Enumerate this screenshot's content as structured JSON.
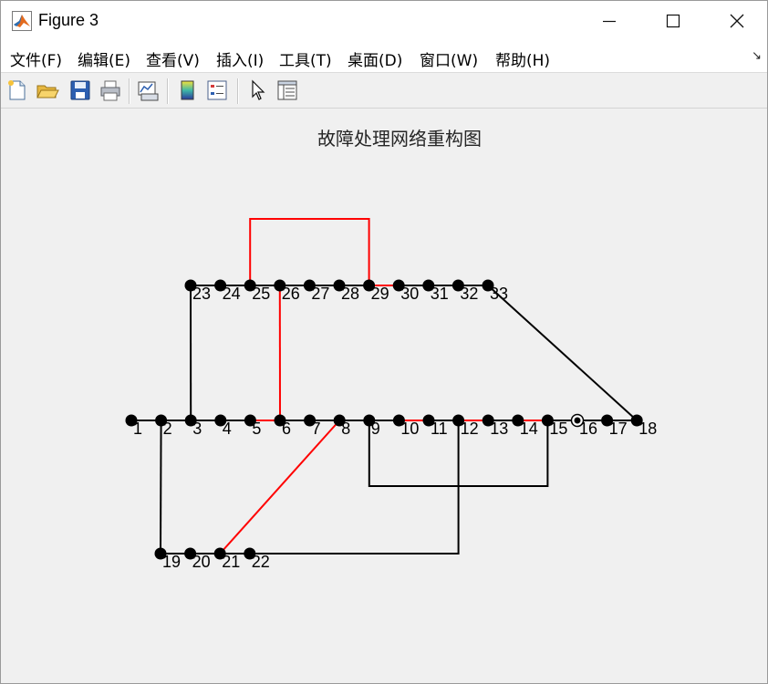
{
  "window": {
    "title": "Figure 3"
  },
  "menu": [
    {
      "label": "文件(F)"
    },
    {
      "label": "编辑(E)"
    },
    {
      "label": "查看(V)"
    },
    {
      "label": "插入(I)"
    },
    {
      "label": "工具(T)"
    },
    {
      "label": "桌面(D)"
    },
    {
      "label": "窗口(W)"
    },
    {
      "label": "帮助(H)"
    }
  ],
  "toolbar": [
    {
      "icon": "new-figure-icon"
    },
    {
      "icon": "open-file-icon"
    },
    {
      "icon": "save-icon"
    },
    {
      "icon": "print-icon"
    },
    {
      "icon": "link-plot-icon"
    },
    {
      "icon": "colorbar-icon"
    },
    {
      "icon": "legend-icon"
    },
    {
      "icon": "pointer-icon"
    },
    {
      "icon": "property-inspector-icon"
    }
  ],
  "figure": {
    "title": "故障处理网络重构图",
    "colors": {
      "black": "#000000",
      "red": "#ff0000"
    },
    "nodes": [
      {
        "id": "1"
      },
      {
        "id": "2"
      },
      {
        "id": "3"
      },
      {
        "id": "4"
      },
      {
        "id": "5"
      },
      {
        "id": "6"
      },
      {
        "id": "7"
      },
      {
        "id": "8"
      },
      {
        "id": "9"
      },
      {
        "id": "10"
      },
      {
        "id": "11"
      },
      {
        "id": "12"
      },
      {
        "id": "13"
      },
      {
        "id": "14"
      },
      {
        "id": "15"
      },
      {
        "id": "16",
        "style": "ring"
      },
      {
        "id": "17"
      },
      {
        "id": "18"
      },
      {
        "id": "19"
      },
      {
        "id": "20"
      },
      {
        "id": "21"
      },
      {
        "id": "22"
      },
      {
        "id": "23"
      },
      {
        "id": "24"
      },
      {
        "id": "25"
      },
      {
        "id": "26"
      },
      {
        "id": "27"
      },
      {
        "id": "28"
      },
      {
        "id": "29"
      },
      {
        "id": "30"
      },
      {
        "id": "31"
      },
      {
        "id": "32"
      },
      {
        "id": "33"
      }
    ],
    "edges": [
      {
        "from": "1",
        "to": "2",
        "color": "black"
      },
      {
        "from": "2",
        "to": "3",
        "color": "black"
      },
      {
        "from": "3",
        "to": "4",
        "color": "black"
      },
      {
        "from": "4",
        "to": "5",
        "color": "black"
      },
      {
        "from": "5",
        "to": "6",
        "color": "red"
      },
      {
        "from": "6",
        "to": "7",
        "color": "black"
      },
      {
        "from": "7",
        "to": "8",
        "color": "black"
      },
      {
        "from": "8",
        "to": "9",
        "color": "black"
      },
      {
        "from": "9",
        "to": "10",
        "color": "black"
      },
      {
        "from": "10",
        "to": "11",
        "color": "red"
      },
      {
        "from": "11",
        "to": "12",
        "color": "black"
      },
      {
        "from": "12",
        "to": "13",
        "color": "red"
      },
      {
        "from": "13",
        "to": "14",
        "color": "black"
      },
      {
        "from": "14",
        "to": "15",
        "color": "red"
      },
      {
        "from": "15",
        "to": "16",
        "color": "black"
      },
      {
        "from": "16",
        "to": "17",
        "color": "black"
      },
      {
        "from": "17",
        "to": "18",
        "color": "black"
      },
      {
        "from": "19",
        "to": "20",
        "color": "black"
      },
      {
        "from": "20",
        "to": "21",
        "color": "black"
      },
      {
        "from": "21",
        "to": "22",
        "color": "black"
      },
      {
        "from": "23",
        "to": "24",
        "color": "black"
      },
      {
        "from": "24",
        "to": "25",
        "color": "black"
      },
      {
        "from": "25",
        "to": "26",
        "color": "black"
      },
      {
        "from": "26",
        "to": "27",
        "color": "black"
      },
      {
        "from": "27",
        "to": "28",
        "color": "black"
      },
      {
        "from": "28",
        "to": "29",
        "color": "black"
      },
      {
        "from": "29",
        "to": "30",
        "color": "red"
      },
      {
        "from": "30",
        "to": "31",
        "color": "black"
      },
      {
        "from": "31",
        "to": "32",
        "color": "black"
      },
      {
        "from": "32",
        "to": "33",
        "color": "black"
      },
      {
        "from": "3",
        "to": "23",
        "color": "black"
      },
      {
        "from": "6",
        "to": "26",
        "color": "red"
      },
      {
        "from": "25",
        "to": "29",
        "color": "red"
      },
      {
        "from": "2",
        "to": "19",
        "color": "black"
      },
      {
        "from": "8",
        "to": "21",
        "color": "red"
      },
      {
        "from": "12",
        "to": "22",
        "color": "black"
      },
      {
        "from": "9",
        "to": "15",
        "color": "black"
      },
      {
        "from": "33",
        "to": "18",
        "color": "black"
      }
    ]
  }
}
